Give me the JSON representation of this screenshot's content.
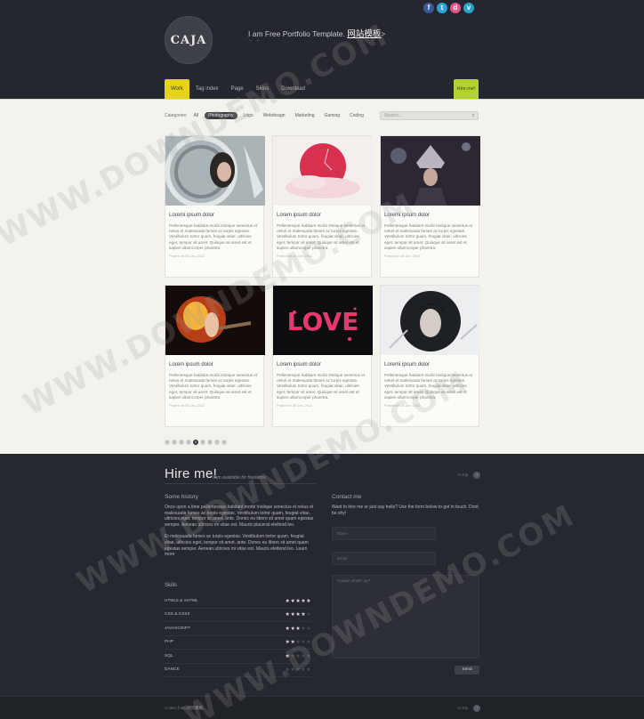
{
  "social": [
    "f",
    "t",
    "d",
    "v"
  ],
  "social_colors": [
    "#3b5998",
    "#2fa4dc",
    "#e05587",
    "#2aa3cc"
  ],
  "logo": "CAJA",
  "tagline": "I am Free Portfolio Template.",
  "tagline_link": "网站模板",
  "tagline_tail": ">",
  "tagline_sub": "← →",
  "nav": [
    "Work",
    "Tag index",
    "Page",
    "Skins",
    "Download"
  ],
  "hire_tab": "Hire me!",
  "categories_label": "Categories:",
  "categories": [
    "All",
    "Photography",
    "Logo",
    "Webdesign",
    "Marketing",
    "Gaming",
    "Coding"
  ],
  "search_placeholder": "Search...",
  "cards": [
    {
      "title": "Loremi ipsum dolor",
      "desc": "Pellentesque habitant morbi tristique senectus et netus et malesuada fames ac turpis egestas. Vestibulum tortor quam, feugiat vitae, ultricies eget, tempor sit amet. Quisque sit amet est et sapien ullamcorper pharetra.",
      "meta": "Posted on 08 Jan, 2012"
    },
    {
      "title": "Lorem ipsum dolor",
      "desc": "Pellentesque habitant morbi tristique senectus et netus et malesuada fames ac turpis egestas. Vestibulum tortor quam, feugiat vitae, ultricies eget, tempor sit amet. Quisque sit amet est et sapien ullamcorper pharetra.",
      "meta": "Posted on 08 Jan, 2012"
    },
    {
      "title": "Loremi ipsum dolor",
      "desc": "Pellentesque habitant morbi tristique senectus et netus et malesuada fames ac turpis egestas. Vestibulum tortor quam, feugiat vitae, ultricies eget, tempor sit amet. Quisque sit amet est et sapien ullamcorper pharetra.",
      "meta": "Posted on 08 Jan, 2012"
    },
    {
      "title": "Lorem ipsum dolor",
      "desc": "Pellentesque habitant morbi tristique senectus et netus et malesuada fames ac turpis egestas. Vestibulum tortor quam, feugiat vitae, ultricies eget, tempor sit amet. Quisque sit amet est et sapien ullamcorper pharetra.",
      "meta": "Posted on 08 Jan, 2012"
    },
    {
      "title": "Lorem ipsum dolor",
      "desc": "Pellentesque habitant morbi tristique senectus et netus et malesuada fames ac turpis egestas. Vestibulum tortor quam, feugiat vitae, ultricies eget, tempor sit amet. Quisque sit amet est et sapien ullamcorper pharetra.",
      "meta": "Posted on 08 Jan, 2012"
    },
    {
      "title": "Loremi ipsum dolor",
      "desc": "Pellentesque habitant morbi tristique senectus et netus et malesuada fames ac turpis egestas. Vestibulum tortor quam, feugiat vitae, ultricies eget, tempor sit amet. Quisque sit amet est et sapien ullamcorper pharetra.",
      "meta": "Posted on 08 Jan, 2012"
    }
  ],
  "pager": [
    "«",
    "1",
    "2",
    "3",
    "4",
    "5",
    "6",
    "7",
    "»"
  ],
  "pager_current": "4",
  "hire": {
    "title": "Hire me!",
    "subtitle": "I am available for freelance",
    "right": "to top",
    "story_heading": "Some history",
    "story_p1": "Once upon a time pellentesque habitant morbi tristique senectus et netus et malesuada fames ac turpis egestas. Vestibulum tortor quam, feugiat vitae, ultricies eget, tempor sit amet, ante. Donec eu libero sit amet quam egestas semper. Aenean ultricies mi vitae est. Mauris placerat eleifend leo.",
    "story_p2": "Et malesuada fames ac turpis egestas. Vestibulum tortor quam, feugiat vitae, ultricies eget, tempor sit amet, ante. Donec eu libero sit amet quam egestas semper. Aenean ultricies mi vitae est. Mauris eleifend leo. Learn more",
    "skills_heading": "Skills",
    "skills": [
      {
        "name": "HTML5 & XHTML",
        "stars": 5
      },
      {
        "name": "CSS & CSS3",
        "stars": 4
      },
      {
        "name": "JAVASCRIPT",
        "stars": 3
      },
      {
        "name": "PHP",
        "stars": 2
      },
      {
        "name": "SQL",
        "stars": 1
      },
      {
        "name": "DANCE",
        "stars": 0
      }
    ],
    "contact_heading": "Contact me",
    "contact_text": "Want to hire me or just say hello? Use the form below to get in touch. Dont be shy!",
    "name_placeholder": "Name",
    "email_placeholder": "Email",
    "message_placeholder": "Howdy, what's up?",
    "send": "Send"
  },
  "footer": {
    "left": "Collect from",
    "left_link": "网页模板",
    "right": "to top"
  },
  "watermark": "WWW.DOWNDEMO.COM"
}
